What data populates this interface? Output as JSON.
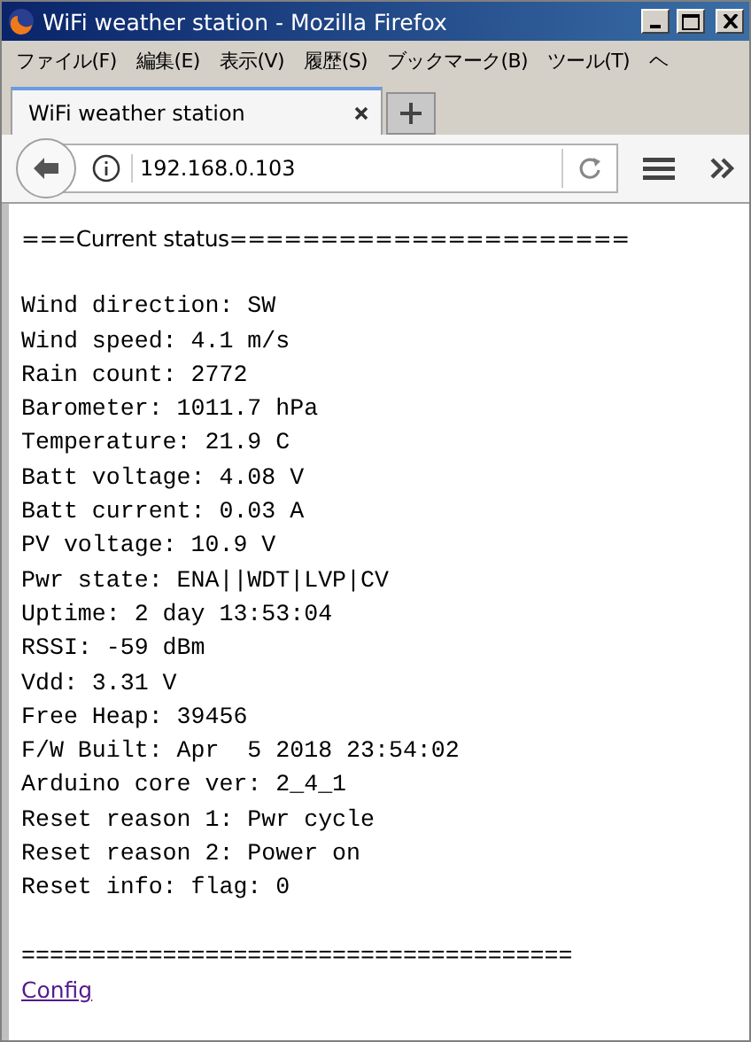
{
  "window": {
    "title": "WiFi weather station - Mozilla Firefox"
  },
  "menu": [
    "ファイル(F)",
    "編集(E)",
    "表示(V)",
    "履歴(S)",
    "ブックマーク(B)",
    "ツール(T)",
    "ヘ"
  ],
  "tabs": [
    {
      "label": "WiFi weather station",
      "selected": true
    }
  ],
  "address": {
    "value": "192.168.0.103"
  },
  "page": {
    "header": "===Current status======================",
    "lines": [
      "Wind direction: SW",
      "Wind speed: 4.1 m/s",
      "Rain count: 2772",
      "Barometer: 1011.7 hPa",
      "Temperature: 21.9 C",
      "Batt voltage: 4.08 V",
      "Batt current: 0.03 A",
      "PV voltage: 10.9 V",
      "Pwr state: ENA||WDT|LVP|CV",
      "Uptime: 2 day 13:53:04",
      "RSSI: -59 dBm",
      "Vdd: 3.31 V",
      "Free Heap: 39456",
      "F/W Built: Apr  5 2018 23:54:02",
      "Arduino core ver: 2_4_1",
      "Reset reason 1: Pwr cycle",
      "Reset reason 2: Power on",
      "Reset info: flag: 0"
    ],
    "footer": "=======================================",
    "link": "Config"
  }
}
